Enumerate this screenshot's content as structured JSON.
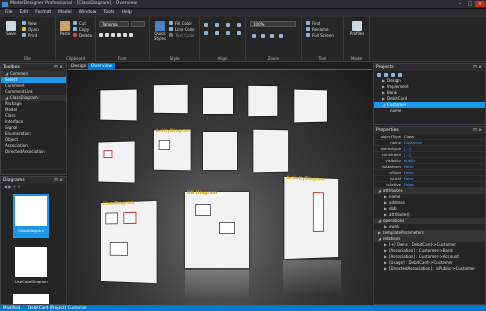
{
  "window": {
    "title": "ModelDesigner Professional - [ClassDiagram] - Overview"
  },
  "menu": [
    "File",
    "Edit",
    "Format",
    "Model",
    "Window",
    "Tools",
    "Help"
  ],
  "ribbon": {
    "file": {
      "save": "Save",
      "new": "New",
      "open": "Open",
      "print": "Print",
      "label": "File"
    },
    "clipboard": {
      "paste": "Paste",
      "cut": "Cut",
      "copy": "Copy",
      "delete": "Delete",
      "label": "Clipboard"
    },
    "font": {
      "family": "Tahoma",
      "size": "",
      "label": "Font"
    },
    "style": {
      "quick": "Quick Styles",
      "fill": "Fill Color",
      "line": "Line Color",
      "text": "Text Color",
      "label": "Style"
    },
    "align": {
      "label": "Align"
    },
    "zoom": {
      "value": "100%",
      "label": "Zoom"
    },
    "tool": {
      "find": "Find",
      "rename": "Rename",
      "fullscreen": "Full Screen",
      "label": "Tool"
    },
    "mode": {
      "profiles": "Profiles",
      "label": "Mode"
    }
  },
  "toolbox": {
    "title": "Toolbox",
    "items": [
      "Common",
      "Select",
      "Comment",
      "CommentLink",
      "ClassDiagram",
      "Package",
      "Model",
      "Class",
      "Interface",
      "Signal",
      "Enumeration",
      "Object",
      "Association",
      "DirectedAssociation"
    ]
  },
  "diagrams": {
    "title": "Diagrams",
    "items": [
      "ClassDiagram",
      "UseCaseDiagram"
    ]
  },
  "tabs": [
    "Design",
    "Overview"
  ],
  "sheets": [
    "ClassDiagram",
    "EntityDiagram",
    "DB Diagram",
    "ActivityDiagram"
  ],
  "projects": {
    "title": "Projects",
    "items": [
      "Design",
      "Implement",
      "Bank",
      "DebitCard",
      "Customer",
      "name"
    ]
  },
  "properties": {
    "title": "Properties",
    "rows": [
      {
        "k": "objectType",
        "v": "Class"
      },
      {
        "k": "name",
        "v": "Customer"
      },
      {
        "k": "stereotype",
        "v": "[...]"
      },
      {
        "k": "constraint",
        "v": "[...]"
      },
      {
        "k": "visibility",
        "v": "public"
      },
      {
        "k": "isAbstract",
        "v": "False"
      },
      {
        "k": "isRoot",
        "v": "False"
      },
      {
        "k": "isLeaf",
        "v": "False"
      },
      {
        "k": "isActive",
        "v": "False"
      }
    ],
    "sections": [
      "attributes",
      "name",
      "address",
      "dob",
      "attribute()",
      "operations",
      "ownk",
      "templateParameters",
      "relations"
    ],
    "relations": [
      "[+] Owns : DebitCard->Customer",
      "[Association] : Customer->Bank",
      "[Association] : Customer->Account",
      "[Usage] : DebitCard->Customer",
      "[DirectedAssociation] : isPublic->Customer"
    ]
  },
  "status": [
    "Modified",
    "DebitCard (Project) Customer"
  ]
}
